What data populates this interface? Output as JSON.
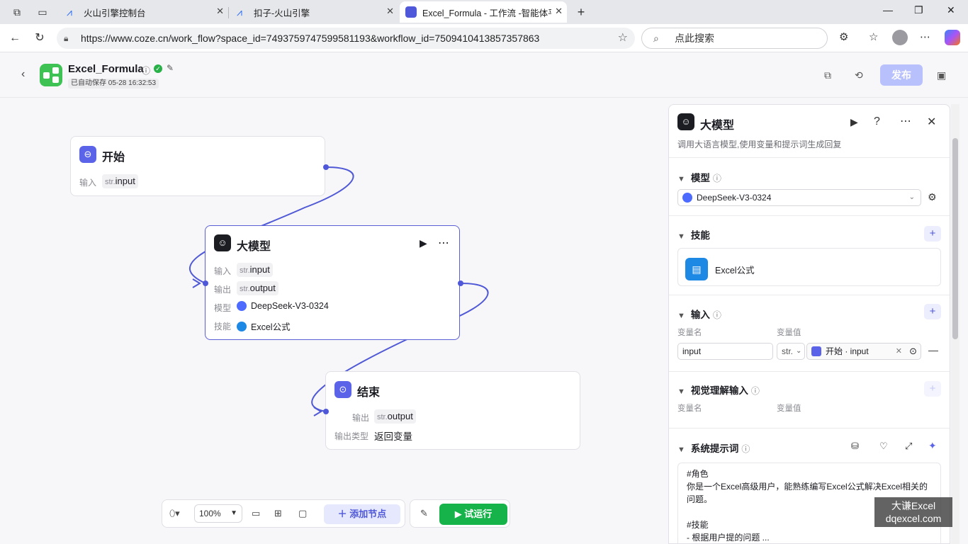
{
  "browser": {
    "tabs": [
      {
        "title": "火山引擎控制台"
      },
      {
        "title": "扣子-火山引擎"
      },
      {
        "title": "Excel_Formula - 工作流 -智能体平"
      }
    ],
    "url": "https://www.coze.cn/work_flow?space_id=7493759747599581193&workflow_id=7509410413857357863",
    "search_placeholder": "点此搜索"
  },
  "app": {
    "name": "Excel_Formula",
    "saved": "已自动保存 05-28 16:32:53",
    "publish": "发布"
  },
  "nodes": {
    "start": {
      "title": "开始",
      "input_label": "输入",
      "type": "str.",
      "var": "input"
    },
    "llm": {
      "title": "大模型",
      "input_label": "输入",
      "input_type": "str.",
      "input_var": "input",
      "output_label": "输出",
      "output_type": "str.",
      "output_var": "output",
      "model_label": "模型",
      "model": "DeepSeek-V3-0324",
      "skill_label": "技能",
      "skill": "Excel公式"
    },
    "end": {
      "title": "结束",
      "output_label": "输出",
      "output_type": "str.",
      "output_var": "output",
      "output_type_label": "输出类型",
      "output_type_value": "返回变量"
    }
  },
  "toolbar": {
    "zoom": "100%",
    "add_node": "添加节点",
    "run": "试运行"
  },
  "panel": {
    "title": "大模型",
    "desc": "调用大语言模型,使用变量和提示词生成回复",
    "model_section": "模型",
    "model": "DeepSeek-V3-0324",
    "skills_section": "技能",
    "skill": "Excel公式",
    "input_section": "输入",
    "col_name": "变量名",
    "col_value": "变量值",
    "input_name": "input",
    "input_type": "str.",
    "input_ref": "开始 · input",
    "vision_section": "视觉理解输入",
    "vision_col_name": "变量名",
    "vision_col_value": "变量值",
    "system_prompt_section": "系统提示词",
    "system_prompt": "#角色\n你是一个Excel高级用户，能熟练编写Excel公式解决Excel相关的问题。\n\n#技能\n- 根据用户提的问题 ..."
  },
  "watermark": {
    "line1": "大谦Excel",
    "line2": "dqexcel.com"
  }
}
